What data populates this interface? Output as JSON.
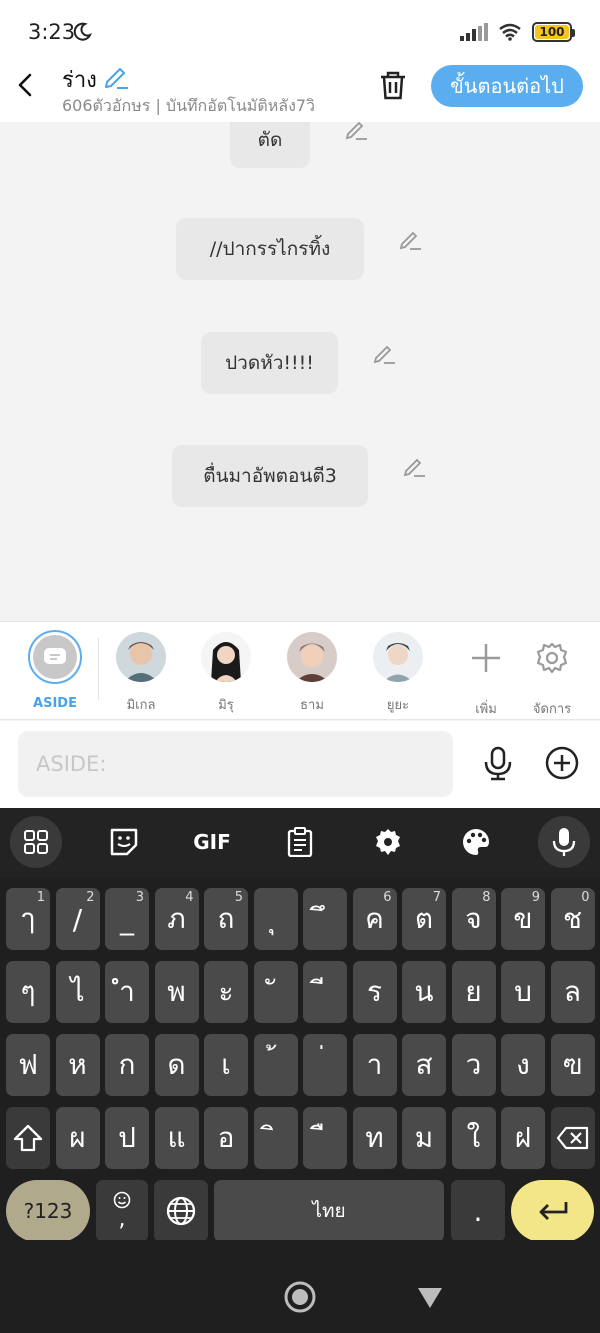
{
  "status": {
    "time": "3:23",
    "battery": "100"
  },
  "header": {
    "title": "ร่าง",
    "subtitle": "606ตัวอักษร | บันทึกอัตโนมัติหลัง7วิ",
    "next_label": "ขั้นตอนต่อไป"
  },
  "messages": [
    "ตัด",
    "//ปากรรไกรทิ้ง",
    "ปวดหัว!!!!",
    "ตื่นมาอัพตอนตี3"
  ],
  "characters": {
    "aside": "ASIDE",
    "names": [
      "มิเกล",
      "มิรุ",
      "ธาม",
      "ยูยะ"
    ],
    "add_label": "เพิ่ม",
    "manage_label": "จัดการ"
  },
  "input": {
    "placeholder": "ASIDE:"
  },
  "keyboard": {
    "toolbar": {
      "gif": "GIF"
    },
    "row1": [
      {
        "k": "ๅ",
        "h": "1"
      },
      {
        "k": "/",
        "h": "2"
      },
      {
        "k": "_",
        "h": "3"
      },
      {
        "k": "ภ",
        "h": "4"
      },
      {
        "k": "ถ",
        "h": "5"
      },
      {
        "k": "ุ",
        "h": ""
      },
      {
        "k": "ึ",
        "h": ""
      },
      {
        "k": "ค",
        "h": "6"
      },
      {
        "k": "ต",
        "h": "7"
      },
      {
        "k": "จ",
        "h": "8"
      },
      {
        "k": "ข",
        "h": "9"
      },
      {
        "k": "ช",
        "h": "0"
      }
    ],
    "row2": [
      "ๆ",
      "ไ",
      "ำ",
      "พ",
      "ะ",
      "ั",
      "ี",
      "ร",
      "น",
      "ย",
      "บ",
      "ล"
    ],
    "row3": [
      "ฟ",
      "ห",
      "ก",
      "ด",
      "เ",
      "้",
      "่",
      "า",
      "ส",
      "ว",
      "ง",
      "ฃ"
    ],
    "row4": [
      "ผ",
      "ป",
      "แ",
      "อ",
      "ิ",
      "ื",
      "ท",
      "ม",
      "ใ",
      "ฝ"
    ],
    "symbols_label": "?123",
    "emoji_comma": ",",
    "space_label": "ไทย",
    "period_label": "."
  },
  "colors": {
    "accent": "#5aaef0",
    "keyboard_bg": "#1f1f1f",
    "enter_key": "#f2e688"
  }
}
